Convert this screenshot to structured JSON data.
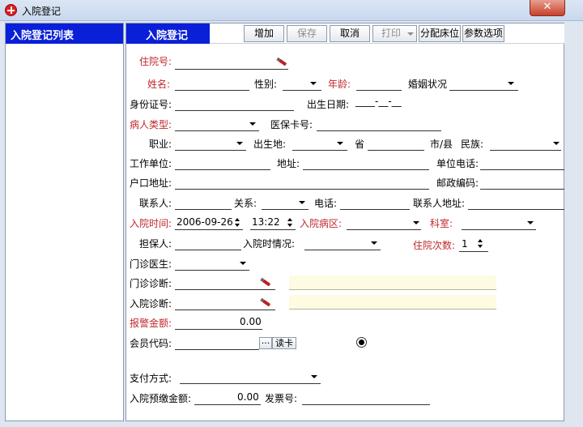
{
  "window": {
    "title": "入院登记",
    "close_label": "✕"
  },
  "left_panel": {
    "header": "入院登记列表"
  },
  "form_tab": {
    "label": "入院登记"
  },
  "toolbar": {
    "add": "增加",
    "save": "保存",
    "cancel": "取消",
    "print": "打印",
    "assign_bed": "分配床位",
    "options": "参数选项"
  },
  "fields": {
    "hospital_no": {
      "label": "住院号:",
      "value": ""
    },
    "name": {
      "label": "姓名:",
      "value": ""
    },
    "gender": {
      "label": "性别:",
      "value": ""
    },
    "age": {
      "label": "年龄:",
      "value": ""
    },
    "marital": {
      "label": "婚姻状况",
      "value": ""
    },
    "id_card": {
      "label": "身份证号:",
      "value": ""
    },
    "birth_date": {
      "label": "出生日期:",
      "value": "____-__-__"
    },
    "patient_type": {
      "label": "病人类型:",
      "value": ""
    },
    "insurance_card": {
      "label": "医保卡号:",
      "value": ""
    },
    "occupation": {
      "label": "职业:",
      "value": ""
    },
    "birthplace": {
      "label": "出生地:",
      "value": ""
    },
    "province": {
      "label": "省",
      "value": ""
    },
    "city": {
      "label": "市/县",
      "value": ""
    },
    "ethnicity": {
      "label": "民族:",
      "value": ""
    },
    "workplace": {
      "label": "工作单位:",
      "value": ""
    },
    "address": {
      "label": "地址:",
      "value": ""
    },
    "work_phone": {
      "label": "单位电话:",
      "value": ""
    },
    "household": {
      "label": "户口地址:",
      "value": ""
    },
    "postcode": {
      "label": "邮政编码:",
      "value": ""
    },
    "contact": {
      "label": "联系人:",
      "value": ""
    },
    "relation": {
      "label": "关系:",
      "value": ""
    },
    "phone": {
      "label": "电话:",
      "value": ""
    },
    "contact_address": {
      "label": "联系人地址:",
      "value": ""
    },
    "admit_time": {
      "label": "入院时间:",
      "date": "2006-09-26",
      "time": "13:22"
    },
    "ward": {
      "label": "入院病区:",
      "value": ""
    },
    "department": {
      "label": "科室:",
      "value": ""
    },
    "guarantor": {
      "label": "担保人:",
      "value": ""
    },
    "admit_condition": {
      "label": "入院时情况:",
      "value": ""
    },
    "admit_count": {
      "label": "住院次数:",
      "value": "1"
    },
    "outpatient_doctor": {
      "label": "门诊医生:",
      "value": ""
    },
    "outpatient_diag": {
      "label": "门诊诊断:",
      "value": ""
    },
    "admit_diag": {
      "label": "入院诊断:",
      "value": ""
    },
    "alert_amount": {
      "label": "报警金额:",
      "value": "0.00"
    },
    "member_code": {
      "label": "会员代码:",
      "value": "",
      "dots": "···",
      "read_card": "读卡"
    },
    "payment_method": {
      "label": "支付方式:",
      "value": ""
    },
    "prepay_amount": {
      "label": "入院预缴金额:",
      "value": "0.00"
    },
    "invoice_no": {
      "label": "发票号:",
      "value": ""
    }
  },
  "colors": {
    "header_blue": "#0a1fd8",
    "required_red": "#c0282c",
    "diag_yellow": "#fdfbe2"
  }
}
